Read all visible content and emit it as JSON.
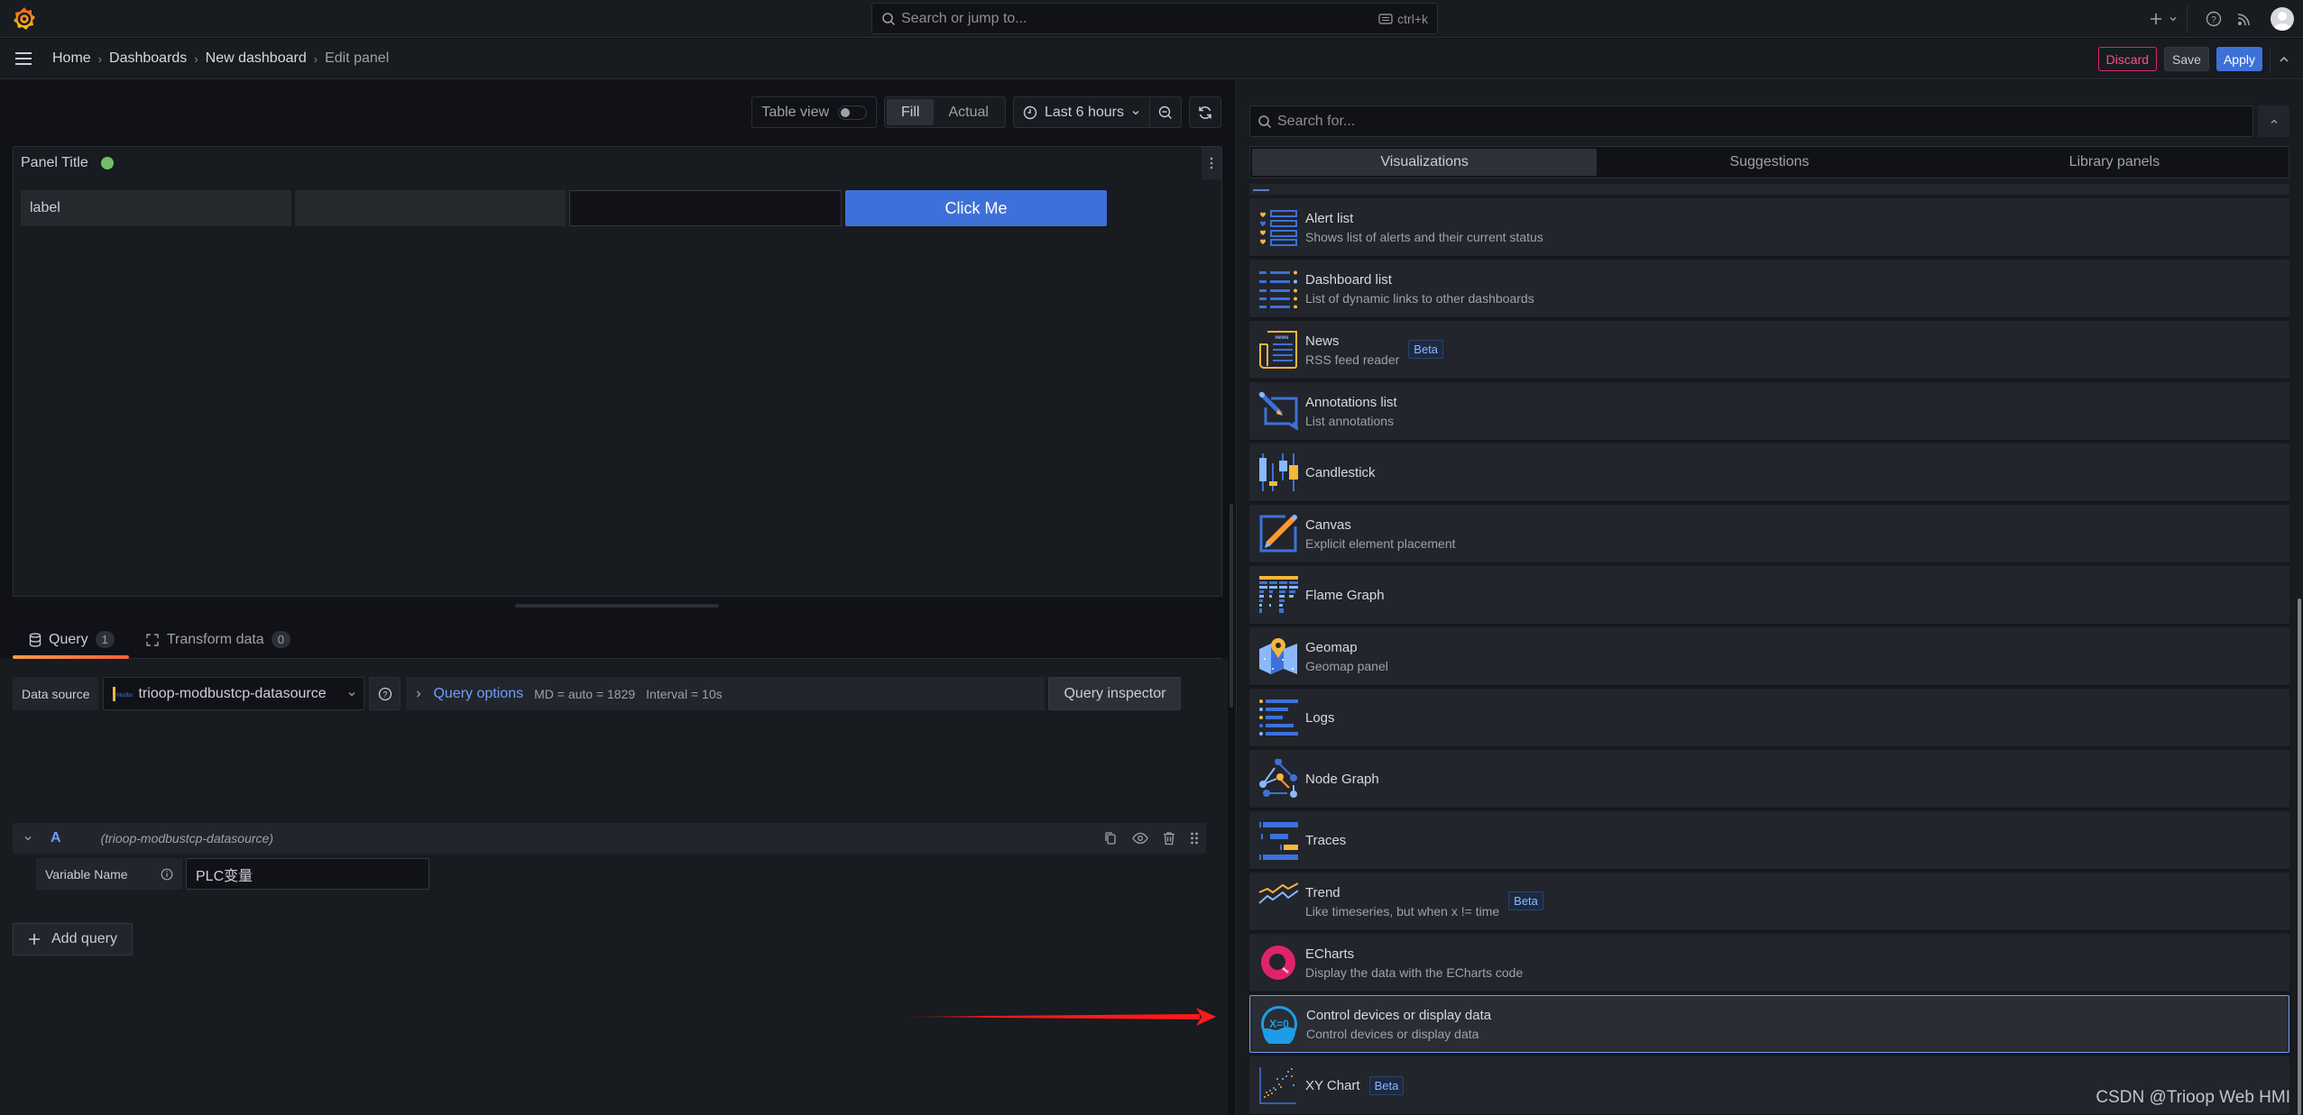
{
  "topbar": {
    "search_placeholder": "Search or jump to...",
    "search_shortcut": "ctrl+k",
    "icons": [
      "grafana-logo-icon",
      "search-icon",
      "keyboard-icon",
      "plus-icon",
      "chevron-down-icon",
      "help-icon",
      "rss-icon",
      "user-avatar-icon"
    ]
  },
  "breadcrumb": {
    "items": [
      "Home",
      "Dashboards",
      "New dashboard",
      "Edit panel"
    ],
    "separator": "›"
  },
  "actions": {
    "discard": "Discard",
    "save": "Save",
    "apply": "Apply"
  },
  "toolbar": {
    "table_view_label": "Table view",
    "table_view_on": false,
    "fill": "Fill",
    "actual": "Actual",
    "active_mode": "Fill",
    "time_range": "Last 6 hours"
  },
  "panel": {
    "title": "Panel Title",
    "status_color": "#73bf69",
    "widgets": {
      "label": "label",
      "text_value": "",
      "input_value": "",
      "button": "Click Me"
    }
  },
  "query_tabs": [
    {
      "label": "Query",
      "count": "1",
      "active": true
    },
    {
      "label": "Transform data",
      "count": "0",
      "active": false
    }
  ],
  "query": {
    "data_source_label": "Data source",
    "data_source": "trioop-modbustcp-datasource",
    "options_label": "Query options",
    "md": "MD = auto = 1829",
    "interval": "Interval = 10s",
    "inspector": "Query inspector",
    "ref_id": "A",
    "ref_datasource": "(trioop-modbustcp-datasource)",
    "variable_label": "Variable Name",
    "variable_value": "PLC变量",
    "add_query": "Add query"
  },
  "viz_picker": {
    "search_placeholder": "Search for...",
    "tabs": [
      {
        "label": "Visualizations",
        "active": true
      },
      {
        "label": "Suggestions",
        "active": false
      },
      {
        "label": "Library panels",
        "active": false
      }
    ],
    "items": [
      {
        "name": "Alert list",
        "desc": "Shows list of alerts and their current status",
        "beta": false,
        "icon": "alert-list-icon"
      },
      {
        "name": "Dashboard list",
        "desc": "List of dynamic links to other dashboards",
        "beta": false,
        "icon": "dashboard-list-icon"
      },
      {
        "name": "News",
        "desc": "RSS feed reader",
        "beta": true,
        "icon": "news-icon"
      },
      {
        "name": "Annotations list",
        "desc": "List annotations",
        "beta": false,
        "icon": "annotations-list-icon"
      },
      {
        "name": "Candlestick",
        "desc": "",
        "beta": false,
        "icon": "candlestick-icon"
      },
      {
        "name": "Canvas",
        "desc": "Explicit element placement",
        "beta": false,
        "icon": "canvas-icon"
      },
      {
        "name": "Flame Graph",
        "desc": "",
        "beta": false,
        "icon": "flame-graph-icon"
      },
      {
        "name": "Geomap",
        "desc": "Geomap panel",
        "beta": false,
        "icon": "geomap-icon"
      },
      {
        "name": "Logs",
        "desc": "",
        "beta": false,
        "icon": "logs-icon"
      },
      {
        "name": "Node Graph",
        "desc": "",
        "beta": false,
        "icon": "node-graph-icon"
      },
      {
        "name": "Traces",
        "desc": "",
        "beta": false,
        "icon": "traces-icon"
      },
      {
        "name": "Trend",
        "desc": "Like timeseries, but when x != time",
        "beta": true,
        "icon": "trend-icon"
      },
      {
        "name": "ECharts",
        "desc": "Display the data with the ECharts code",
        "beta": false,
        "icon": "echarts-icon"
      },
      {
        "name": "Control devices or display data",
        "desc": "Control devices or display data",
        "beta": false,
        "icon": "control-devices-icon",
        "selected": true
      },
      {
        "name": "XY Chart",
        "desc": "",
        "beta": true,
        "icon": "xy-chart-icon"
      }
    ],
    "beta_label": "Beta"
  },
  "annotation_arrow": {
    "color": "#ff1a1a",
    "points_to": "Control devices or display data"
  },
  "watermark": "CSDN @Trioop Web HMI"
}
